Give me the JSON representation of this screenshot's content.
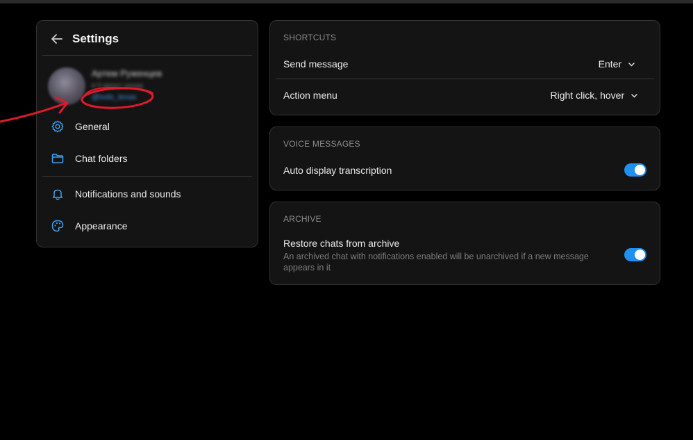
{
  "settings": {
    "title": "Settings",
    "profile": {
      "name": "Артем Руженцев",
      "status": "в 5 минут назад",
      "username": "@tvdo_texas"
    },
    "nav_items": [
      {
        "label": "General",
        "icon": "gear-icon"
      },
      {
        "label": "Chat folders",
        "icon": "folder-icon"
      },
      {
        "label": "Notifications and sounds",
        "icon": "bell-icon"
      },
      {
        "label": "Appearance",
        "icon": "palette-icon"
      }
    ]
  },
  "shortcuts": {
    "title": "SHORTCUTS",
    "send_message": {
      "label": "Send message",
      "value": "Enter"
    },
    "action_menu": {
      "label": "Action menu",
      "value": "Right click, hover"
    }
  },
  "voice_messages": {
    "title": "VOICE MESSAGES",
    "auto_transcription": {
      "label": "Auto display transcription",
      "enabled": true
    }
  },
  "archive": {
    "title": "ARCHIVE",
    "restore_chats": {
      "label": "Restore chats from archive",
      "description": "An archived chat with notifications enabled will be unarchived if a new message appears in it",
      "enabled": true
    }
  },
  "colors": {
    "background": "#000000",
    "panel": "#141414",
    "accent": "#1f8ff0",
    "annotation": "#e0192d"
  }
}
